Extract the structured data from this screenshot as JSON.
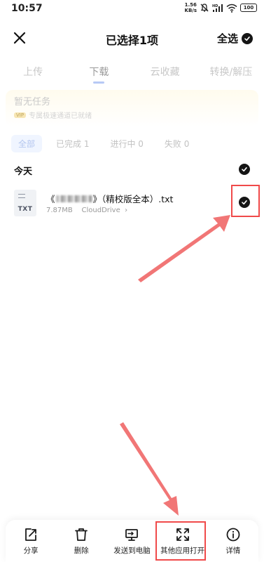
{
  "status_bar": {
    "time": "10:57",
    "net_speed_value": "1.56",
    "net_speed_unit": "KB/s",
    "battery": "100"
  },
  "header": {
    "title": "已选择1项",
    "select_all_label": "全选"
  },
  "tabs": [
    {
      "label": "上传",
      "active": false
    },
    {
      "label": "下载",
      "active": true
    },
    {
      "label": "云收藏",
      "active": false
    },
    {
      "label": "转换/解压",
      "active": false
    }
  ],
  "task_banner": {
    "title": "暂无任务",
    "vip_tag": "VIP",
    "subtitle": "专属极速通道已就绪"
  },
  "filters": [
    {
      "label": "全部",
      "active": true
    },
    {
      "label": "已完成 1",
      "active": false
    },
    {
      "label": "进行中 0",
      "active": false
    },
    {
      "label": "失败 0",
      "active": false
    }
  ],
  "section": {
    "label": "今天"
  },
  "file": {
    "icon_type": "TXT",
    "name_prefix": "《",
    "name_suffix": "》（精校版全本）.txt",
    "size": "7.87MB",
    "location": "CloudDrive",
    "selected": true
  },
  "bottom_actions": [
    {
      "label": "分享",
      "icon": "share-icon"
    },
    {
      "label": "删除",
      "icon": "trash-icon"
    },
    {
      "label": "发送到电脑",
      "icon": "send-to-pc-icon"
    },
    {
      "label": "其他应用打开",
      "icon": "open-with-icon"
    },
    {
      "label": "详情",
      "icon": "info-icon"
    }
  ],
  "colors": {
    "annotation_red": "#f04a4a",
    "check_fill": "#151515"
  }
}
